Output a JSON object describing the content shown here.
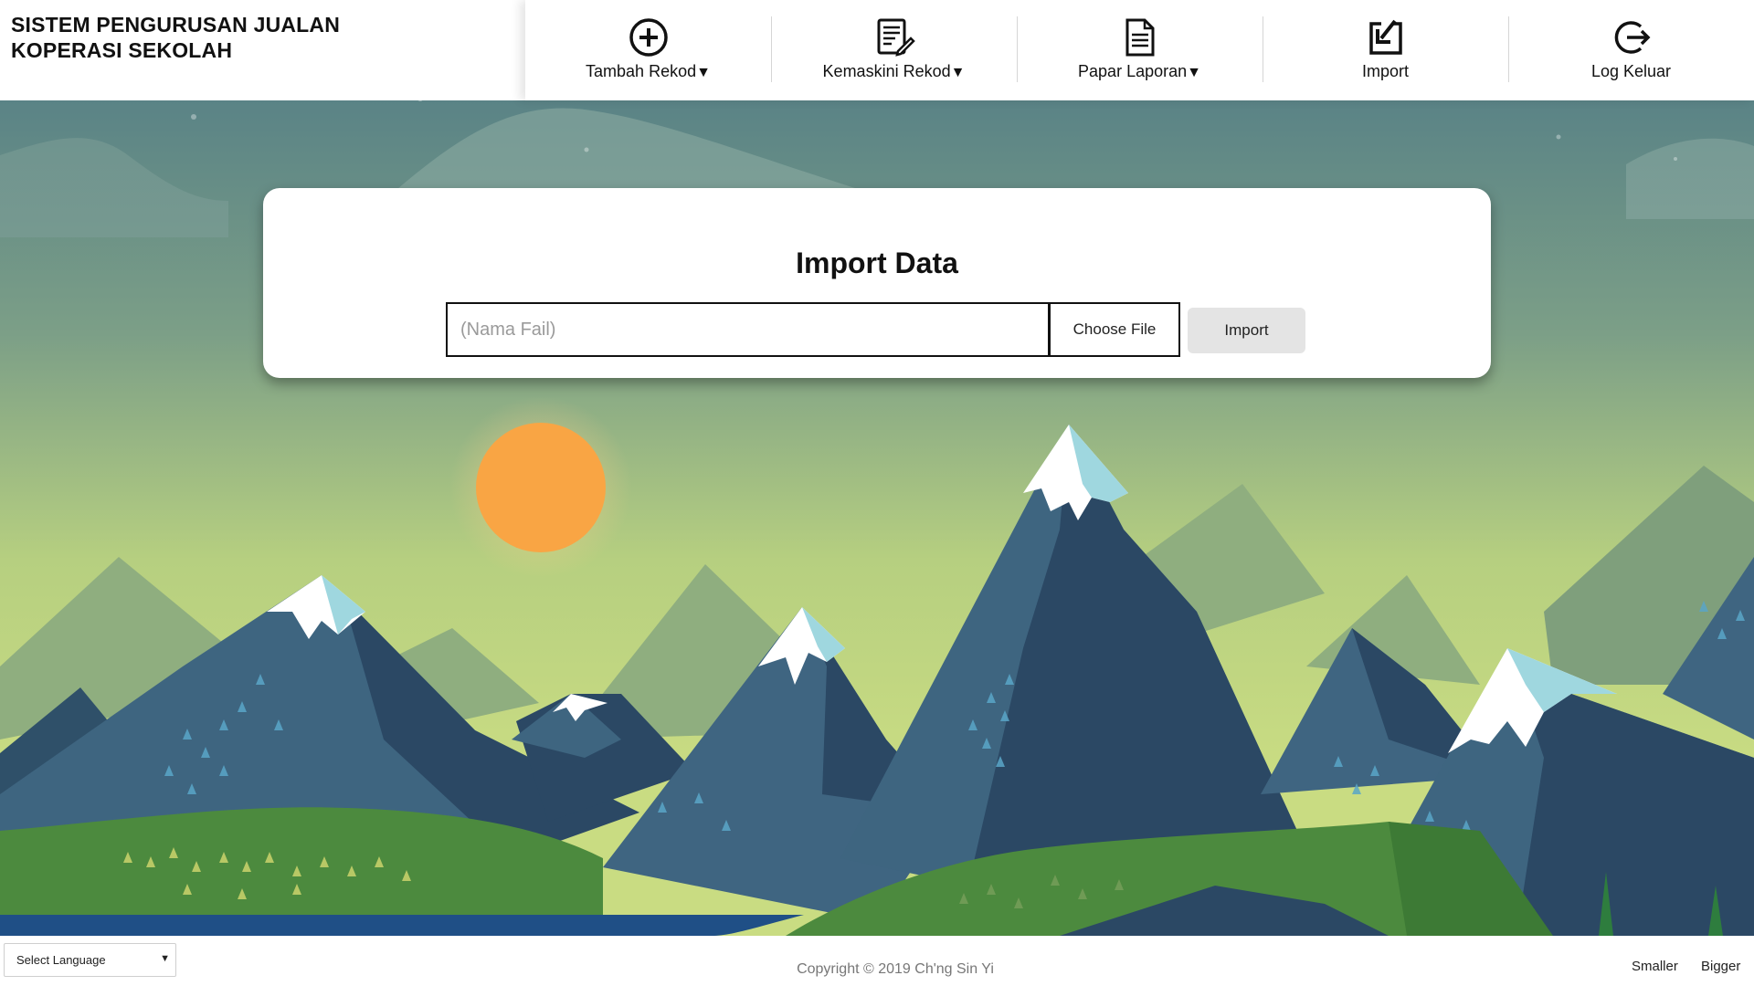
{
  "app": {
    "title_line1": "SISTEM PENGURUSAN JUALAN",
    "title_line2": "KOPERASI SEKOLAH"
  },
  "nav": {
    "items": [
      {
        "label": "Tambah Rekod",
        "has_dropdown": true,
        "dropdown_mark": "▼",
        "icon": "add-circle-icon"
      },
      {
        "label": "Kemaskini Rekod",
        "has_dropdown": true,
        "dropdown_mark": "▼",
        "icon": "edit-document-icon"
      },
      {
        "label": "Papar Laporan",
        "has_dropdown": true,
        "dropdown_mark": "▼",
        "icon": "report-document-icon"
      },
      {
        "label": "Import",
        "has_dropdown": false,
        "icon": "import-icon"
      },
      {
        "label": "Log Keluar",
        "has_dropdown": false,
        "icon": "logout-icon"
      }
    ]
  },
  "import_form": {
    "title": "Import Data",
    "file_placeholder": "(Nama Fail)",
    "choose_label": "Choose File",
    "import_label": "Import"
  },
  "footer": {
    "language_select": "Select Language",
    "copyright": "Copyright © 2019 Ch'ng Sin Yi",
    "smaller_label": "Smaller",
    "bigger_label": "Bigger"
  },
  "colors": {
    "sky_top": "#5f8a89",
    "sky_bottom": "#c3d77d",
    "sun": "#f9a544",
    "mountain_dark": "#2b4864",
    "mountain_mid": "#3f6581",
    "snow": "#ffffff",
    "snow_shade": "#9fd7df",
    "grass": "#4c8a3e",
    "water": "#1f4f86"
  }
}
